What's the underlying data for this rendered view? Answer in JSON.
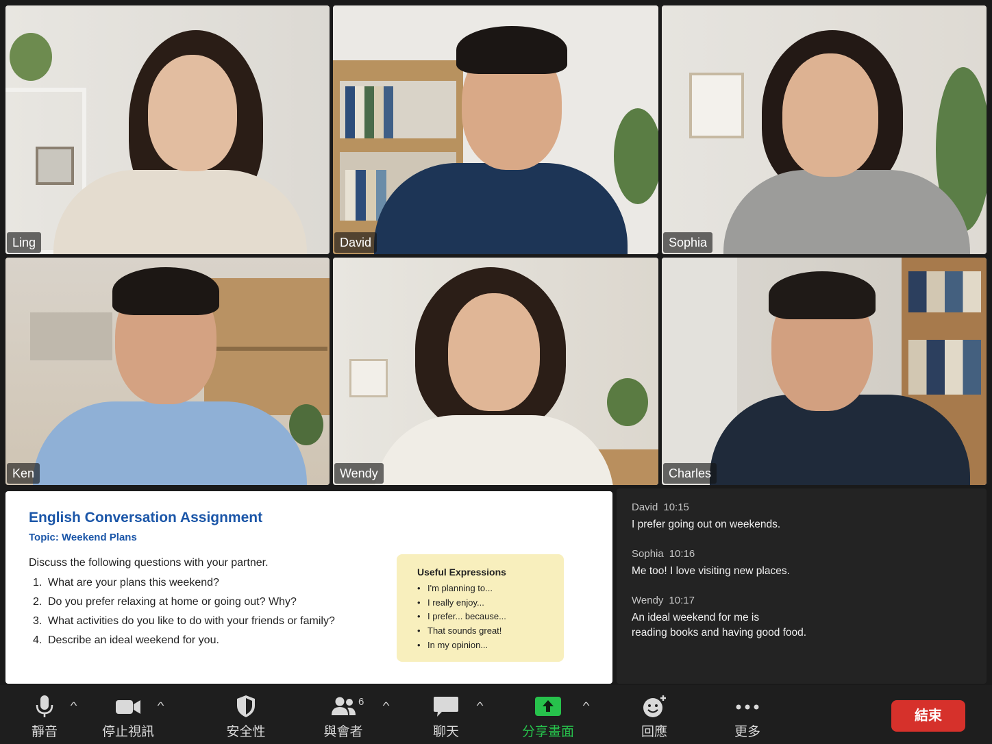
{
  "participants": [
    {
      "name": "Ling"
    },
    {
      "name": "David"
    },
    {
      "name": "Sophia"
    },
    {
      "name": "Ken"
    },
    {
      "name": "Wendy"
    },
    {
      "name": "Charles"
    }
  ],
  "assignment": {
    "title": "English Conversation Assignment",
    "topic": "Topic: Weekend Plans",
    "intro": "Discuss the following questions with your partner.",
    "questions": [
      {
        "num": "1.",
        "text": "What are your plans this weekend?"
      },
      {
        "num": "2.",
        "text": "Do you prefer relaxing at home or going out? Why?"
      },
      {
        "num": "3.",
        "text": "What activities do you like to do with your friends or family?"
      },
      {
        "num": "4.",
        "text": "Describe an ideal weekend for you."
      }
    ],
    "useful_title": "Useful Expressions",
    "useful_items": [
      "I'm planning to...",
      "I really enjoy...",
      "I prefer... because...",
      "That sounds great!",
      "In my opinion..."
    ]
  },
  "chat": [
    {
      "sender": "David",
      "time": "10:15",
      "lines": [
        "I prefer going out on weekends."
      ]
    },
    {
      "sender": "Sophia",
      "time": "10:16",
      "lines": [
        "Me too! I love visiting new places."
      ]
    },
    {
      "sender": "Wendy",
      "time": "10:17",
      "lines": [
        "An ideal weekend for me is",
        "reading books and having good food."
      ]
    }
  ],
  "toolbar": {
    "mute": "靜音",
    "stop_video": "停止視訊",
    "security": "安全性",
    "participants": "與會者",
    "participants_count": "6",
    "chat": "聊天",
    "share": "分享畫面",
    "reactions": "回應",
    "more": "更多",
    "end": "結束",
    "share_color": "#27c24c",
    "end_color": "#d6312b",
    "assignment_title_color": "#1b56a8"
  }
}
